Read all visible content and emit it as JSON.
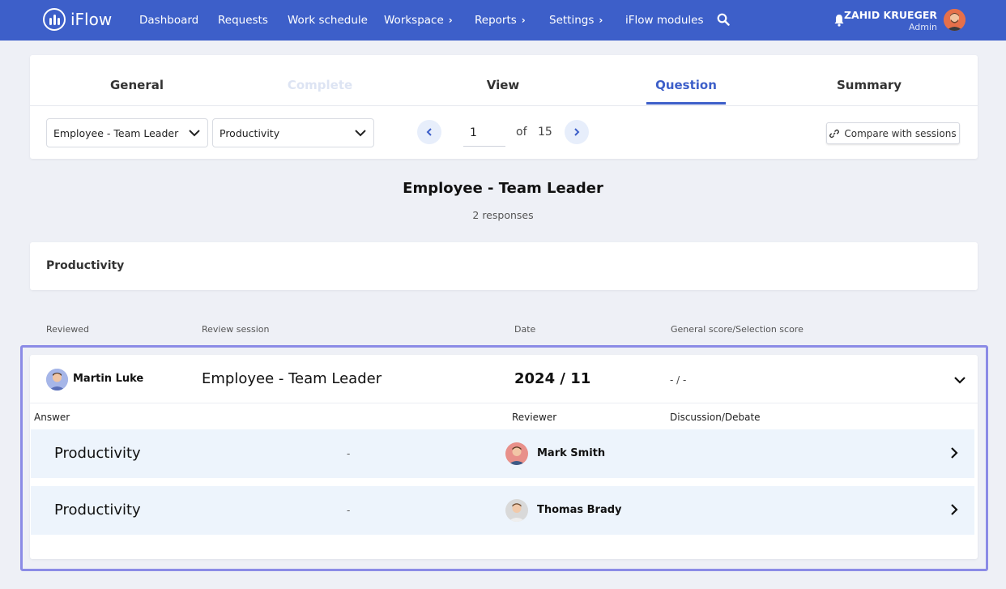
{
  "nav": {
    "logo_text": "iFlow",
    "items": [
      {
        "label": "Dashboard"
      },
      {
        "label": "Requests"
      },
      {
        "label": "Work schedule"
      },
      {
        "label": "Workspace"
      },
      {
        "label": "Reports"
      },
      {
        "label": "Settings"
      },
      {
        "label": "iFlow modules"
      }
    ],
    "submenu_chevron": "›",
    "user_name": "ZAHID KRUEGER",
    "user_role": "Admin",
    "accent_color": "#3d5fc9"
  },
  "tabs": [
    {
      "label": "General"
    },
    {
      "label": "Complete"
    },
    {
      "label": "View"
    },
    {
      "label": "Question"
    },
    {
      "label": "Summary"
    }
  ],
  "filters": {
    "session_select": "Employee - Team Leader",
    "category_select": "Productivity"
  },
  "pager": {
    "current_page": "1",
    "of_label": "of",
    "total_pages": "15"
  },
  "compare_button": "Compare with sessions",
  "summary": {
    "title": "Employee - Team Leader",
    "responses": "2 responses"
  },
  "section_title": "Productivity",
  "table": {
    "headers": {
      "reviewed": "Reviewed",
      "session": "Review session",
      "date": "Date",
      "score": "General score/Selection score"
    },
    "row": {
      "reviewed": "Martin Luke",
      "session": "Employee - Team Leader",
      "date": "2024 / 11",
      "score": "- / -"
    },
    "sub_headers": {
      "answer": "Answer",
      "reviewer": "Reviewer",
      "discussion": "Discussion/Debate"
    },
    "answers": [
      {
        "answer": "Productivity",
        "value": "-",
        "reviewer": "Mark Smith"
      },
      {
        "answer": "Productivity",
        "value": "-",
        "reviewer": "Thomas Brady"
      }
    ]
  }
}
